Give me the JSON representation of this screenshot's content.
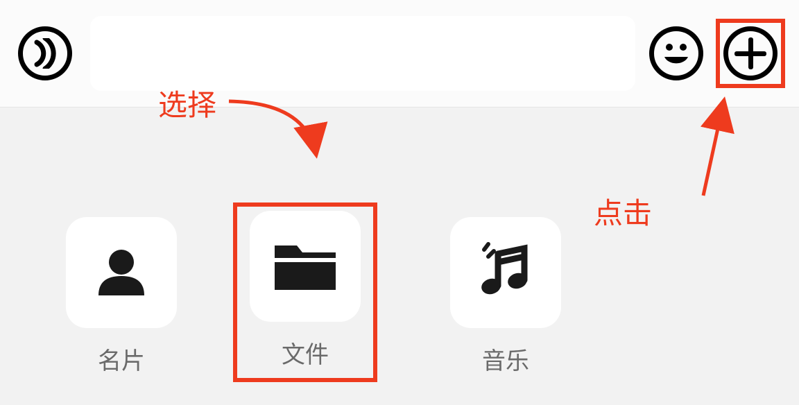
{
  "input_bar": {
    "text_value": ""
  },
  "attachments": {
    "items": [
      {
        "label": "名片",
        "icon": "contact-card-icon"
      },
      {
        "label": "文件",
        "icon": "folder-icon"
      },
      {
        "label": "音乐",
        "icon": "music-icon"
      }
    ]
  },
  "annotations": {
    "select_label": "选择",
    "click_label": "点击",
    "highlight_color": "#ee3b1e"
  }
}
